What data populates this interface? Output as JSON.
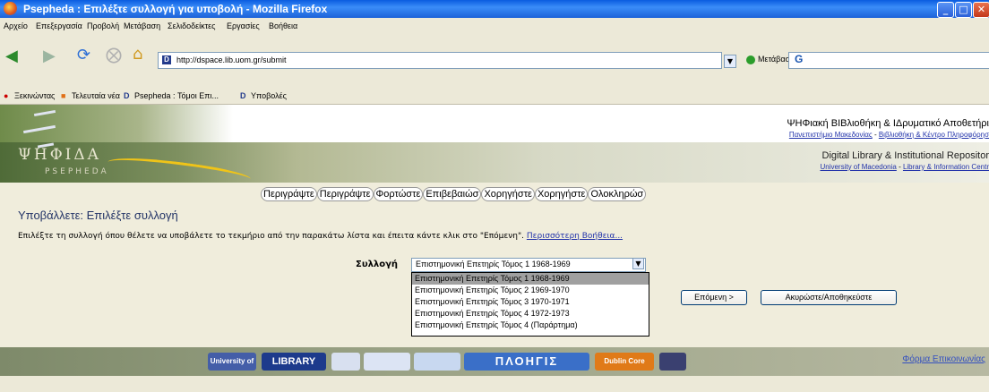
{
  "window": {
    "title": "Psepheda : Επιλέξτε συλλογή για υποβολή - Mozilla Firefox"
  },
  "menu": [
    "Αρχείο",
    "Επεξεργασία",
    "Προβολή",
    "Μετάβαση",
    "Σελιδοδείκτες",
    "Εργασίες",
    "Βοήθεια"
  ],
  "nav": {
    "url": "http://dspace.lib.uom.gr/submit",
    "go_label": "Μετάβαση",
    "search_icon_text": "G"
  },
  "bookmarks": [
    "Ξεκινώντας",
    "Τελευταία νέα",
    "Psepheda : Τόμοι Επι...",
    "Υποβολές"
  ],
  "header": {
    "logo_text": "ΨΗΦΙΔΑ",
    "logo_sub": "PSEPHEDA",
    "gr_title": "ΨΗΦιακή ΒΙΒλιοθήκη & ΙΔρυματικό Αποθετήρι",
    "gr_sub_uni": "Πανεπιστήμιο Μακεδονίας",
    "gr_sub_sep": " - ",
    "gr_sub_lib": "Βιβλιοθήκη & Κέντρο Πληροφόρησ",
    "en_title": "Digital Library & Institutional Repositor",
    "en_sub_uni": "University of Macedonia",
    "en_sub_sep": " - ",
    "en_sub_lib": "Library & Information Centr"
  },
  "steps": [
    "Περιγράψτε",
    "Περιγράψτε",
    "Φορτώστε",
    "Επιβεβαιώσ",
    "Χορηγήστε",
    "Χορηγήστε",
    "Ολοκληρώσ"
  ],
  "page": {
    "title": "Υποβάλλετε: Επιλέξτε συλλογή",
    "instruction": "Επιλέξτε τη συλλογή όπου θέλετε να υποβάλετε το τεκμήριο από την παρακάτω λίστα και έπειτα κάντε κλικ στο \"Επόμενη\".",
    "help_link": "Περισσότερη Βοήθεια...",
    "field_label": "Συλλογή",
    "selected": "Επιστημονική Επετηρίς Τόμος 1 1968-1969",
    "options": [
      "Επιστημονική Επετηρίς Τόμος 1 1968-1969",
      "Επιστημονική Επετηρίς Τόμος 2 1969-1970",
      "Επιστημονική Επετηρίς Τόμος 3 1970-1971",
      "Επιστημονική Επετηρίς Τόμος 4 1972-1973",
      "Επιστημονική Επετηρίς Τόμος 4 (Παράρτημα)"
    ],
    "next_button": "Επόμενη >",
    "cancel_button": "Ακυρώστε/Αποθηκεύστε"
  },
  "footer": {
    "logos": [
      "University of Macedonia",
      "LIBRARY",
      "ΠΛΟΗΓΙΣ",
      "Dublin Core Used Here"
    ],
    "contact": "Φόρμα Επικοινωνίας"
  }
}
